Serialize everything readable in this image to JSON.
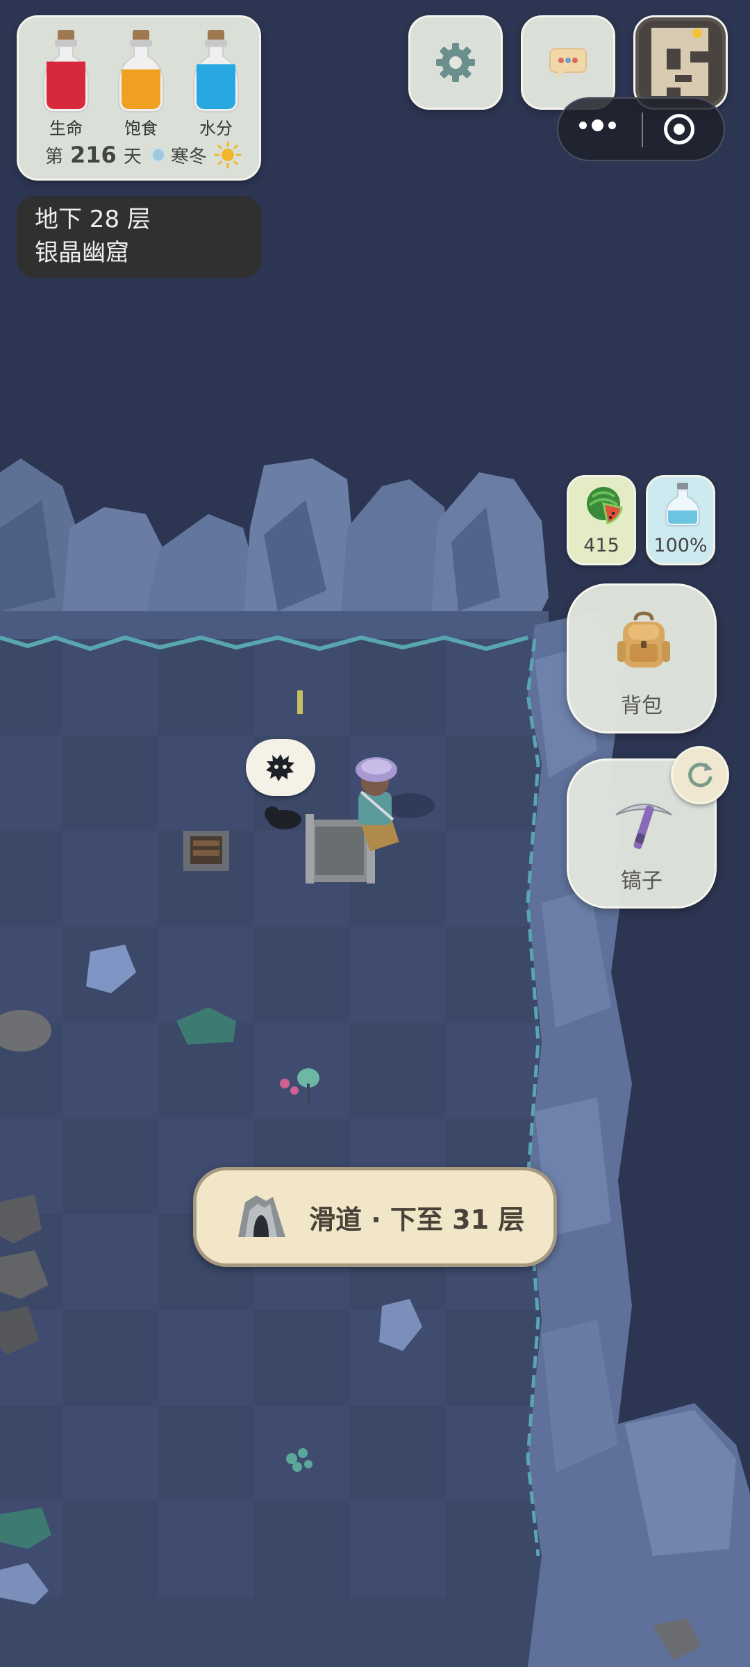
{
  "status": {
    "bottles": [
      {
        "label": "生命",
        "level": 0.9,
        "color": "#d8283c"
      },
      {
        "label": "饱食",
        "level": 0.75,
        "color": "#f0a020"
      },
      {
        "label": "水分",
        "level": 0.85,
        "color": "#28a8e0"
      }
    ],
    "day_prefix": "第",
    "day_number": "216",
    "day_suffix": "天",
    "season": "寒冬",
    "weather_icon": "sun-icon"
  },
  "location": {
    "floor": "地下 28 层",
    "area": "银晶幽窟"
  },
  "top_buttons": {
    "settings_icon": "gear-icon",
    "chat_icon": "chat-bubble-icon",
    "minimap_icon": "minimap-icon"
  },
  "resources": {
    "food_value": "415",
    "food_icon": "watermelon-icon",
    "water_value": "100%",
    "water_icon": "water-bottle-icon"
  },
  "actions": {
    "backpack_label": "背包",
    "tool_label": "镐子",
    "refresh_icon": "refresh-icon"
  },
  "prompt": {
    "chute_label": "滑道 · 下至 31 层"
  },
  "colors": {
    "cave_floor": "#3a4766",
    "rock": "#5b6e95",
    "panel_bg": "#e2e6de",
    "chute_bg": "#f1e6c8"
  }
}
